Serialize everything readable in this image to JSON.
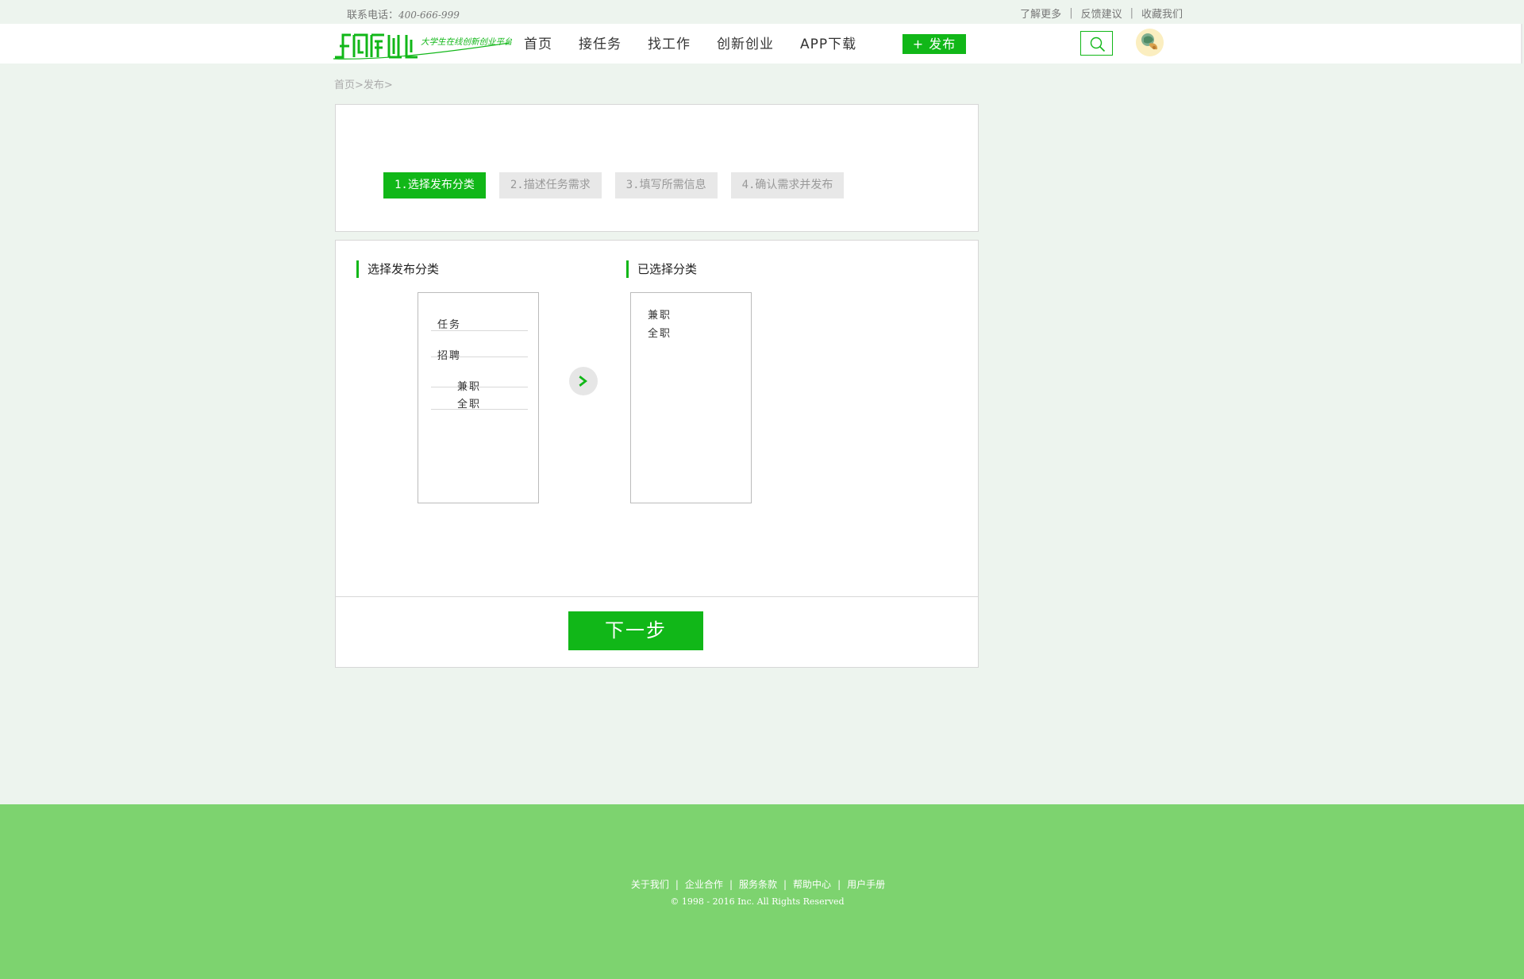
{
  "topbar": {
    "phone_label": "联系电话：",
    "phone_number": "400-666-999",
    "links": [
      "了解更多",
      "反馈建议",
      "收藏我们"
    ],
    "separator": "|"
  },
  "header": {
    "logo_text": "创新创业",
    "logo_slogan": "大学生在线创新创业平台",
    "nav": [
      "首页",
      "接任务",
      "找工作",
      "创新创业",
      "APP下载"
    ],
    "publish_label": "+ 发布"
  },
  "breadcrumb": "首页>发布>",
  "steps": [
    "1.选择发布分类",
    "2.描述任务需求",
    "3.填写所需信息",
    "4.确认需求并发布"
  ],
  "category": {
    "left_title": "选择发布分类",
    "right_title": "已选择分类",
    "categories": [
      "任务",
      "招聘"
    ],
    "subcategories": [
      "兼职",
      "全职"
    ],
    "selected": [
      "兼职",
      "全职"
    ]
  },
  "next_label": "下一步",
  "footer": {
    "links": [
      "关于我们",
      "企业合作",
      "服务条款",
      "帮助中心",
      "用户手册"
    ],
    "separator": "|",
    "copyright": "© 1998 - 2016  Inc. All Rights Reserved"
  },
  "colors": {
    "accent": "#11b718",
    "page_bg": "#edf4ee",
    "footer_bg": "#7dd36f",
    "inactive_step": "#e8e8e8"
  }
}
